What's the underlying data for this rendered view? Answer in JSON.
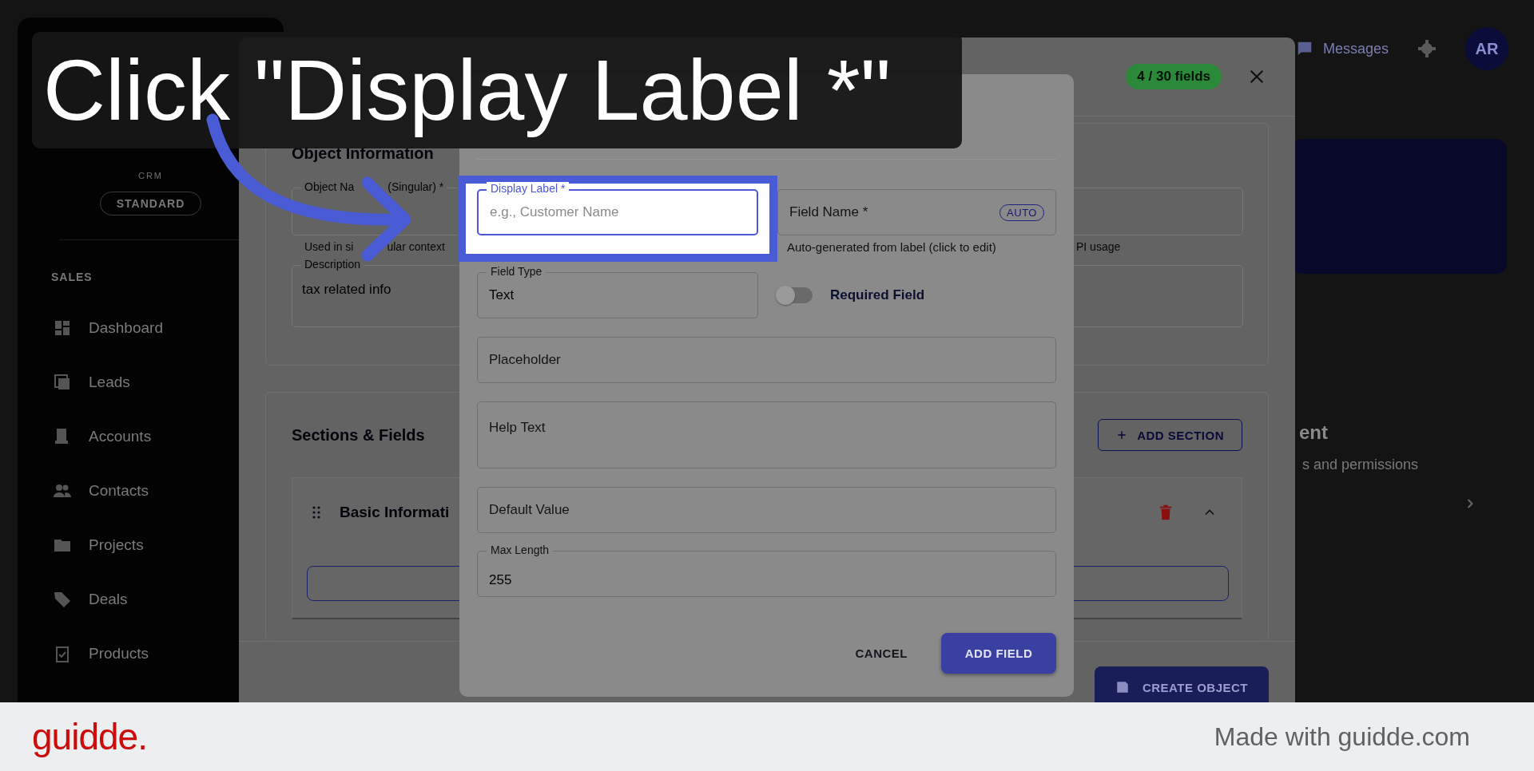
{
  "caption": {
    "text": "Click \"Display Label *\""
  },
  "sidebar": {
    "logo_suffix": "CRM",
    "plan": "STANDARD",
    "section": "SALES",
    "items": [
      {
        "label": "Dashboard"
      },
      {
        "label": "Leads"
      },
      {
        "label": "Accounts"
      },
      {
        "label": "Contacts"
      },
      {
        "label": "Projects"
      },
      {
        "label": "Deals"
      },
      {
        "label": "Products"
      }
    ]
  },
  "topbar": {
    "messages": "Messages",
    "avatar": "AR"
  },
  "side_panel": {
    "heading": "ent",
    "text": "s and permissions"
  },
  "create_dialog": {
    "fields_badge": "4 / 30 fields",
    "object_info": {
      "title": "Object Information",
      "name_field": {
        "label_parts": [
          "Object Na",
          "(Singular) *"
        ],
        "helper_parts": [
          "Used in si",
          "ular context"
        ]
      },
      "api_helper": "PI usage",
      "description": {
        "label": "Description",
        "value": "tax related info"
      }
    },
    "sections": {
      "title": "Sections & Fields",
      "add_button": "ADD SECTION",
      "section_title": "Basic Informati",
      "expanded": true
    },
    "create_button": "CREATE OBJECT"
  },
  "add_field_dialog": {
    "display_label": {
      "label": "Display Label *",
      "placeholder": "e.g., Customer Name",
      "focused": true,
      "highlighted": true
    },
    "field_name": {
      "placeholder": "Field Name *",
      "badge": "AUTO",
      "helper": "Auto-generated from label (click to edit)"
    },
    "field_type": {
      "label": "Field Type",
      "value": "Text"
    },
    "required": {
      "label": "Required Field",
      "on": false
    },
    "inputs": [
      {
        "placeholder": "Placeholder",
        "multiline": false
      },
      {
        "placeholder": "Help Text",
        "multiline": true
      },
      {
        "placeholder": "Default Value",
        "multiline": false
      }
    ],
    "max_length": {
      "label": "Max Length",
      "value": "255"
    },
    "cancel": "CANCEL",
    "submit": "ADD FIELD"
  },
  "footer": {
    "brand": "guidde.",
    "credit": "Made with guidde.com"
  }
}
